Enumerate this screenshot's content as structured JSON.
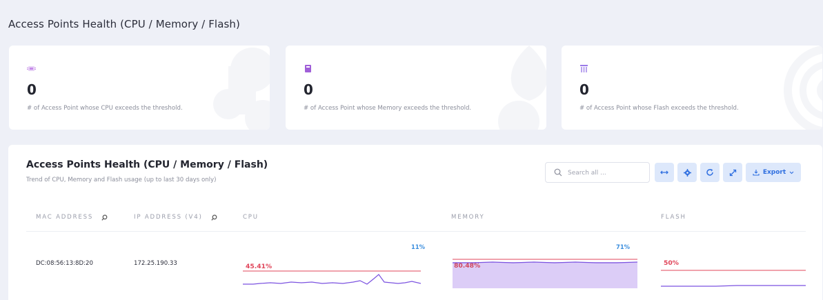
{
  "page": {
    "title": "Access Points Health (CPU / Memory / Flash)"
  },
  "stat_cards": [
    {
      "icon": "cpu-chip-icon",
      "color": "#c68be8",
      "count": "0",
      "description": "# of Access Point whose CPU exceeds the threshold."
    },
    {
      "icon": "memory-card-icon",
      "color": "#a05fd8",
      "count": "0",
      "description": "# of Access Point whose Memory exceeds the threshold."
    },
    {
      "icon": "flash-storage-icon",
      "color": "#9a7ae8",
      "count": "0",
      "description": "# of Access Point whose Flash exceeds the threshold."
    }
  ],
  "panel": {
    "title": "Access Points Health (CPU / Memory / Flash)",
    "subtitle": "Trend of CPU, Memory and Flash usage (up to last 30 days only)",
    "search_placeholder": "Search all ...",
    "export_label": "Export",
    "toolbar_icons": [
      "resize-columns-icon",
      "settings-gear-icon",
      "refresh-icon",
      "fullscreen-icon",
      "export-download-icon",
      "chevron-down-icon"
    ]
  },
  "table": {
    "columns": [
      "MAC ADDRESS",
      "IP ADDRESS (V4)",
      "CPU",
      "MEMORY",
      "FLASH"
    ],
    "rows": [
      {
        "mac": "DC:08:56:13:8D:20",
        "ip": "172.25.190.33",
        "cpu": {
          "current": "11%",
          "threshold": "45.41%"
        },
        "memory": {
          "current": "71%",
          "threshold": "80.48%"
        },
        "flash": {
          "threshold": "50%"
        }
      }
    ]
  },
  "colors": {
    "accent": "#2f6fe0",
    "threshold": "#e0455a",
    "trend_line": "#7b52e0",
    "memory_fill": "#dccdf7",
    "current_value": "#3b8ede"
  }
}
